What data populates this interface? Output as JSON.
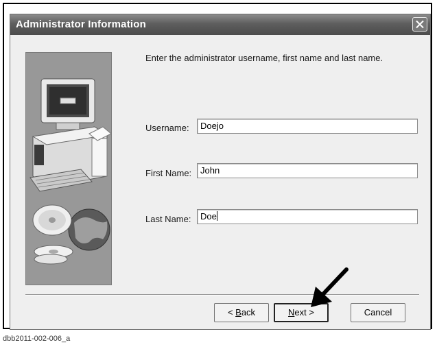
{
  "window": {
    "title": "Administrator Information",
    "close_icon": "close-icon"
  },
  "instruction": "Enter the administrator username, first name and last name.",
  "fields": {
    "username": {
      "label": "Username:",
      "value": "Doejo"
    },
    "first_name": {
      "label": "First Name:",
      "value": "John"
    },
    "last_name": {
      "label": "Last Name:",
      "value": "Doe"
    }
  },
  "buttons": {
    "back": {
      "prefix": "< ",
      "mnemonic": "B",
      "rest": "ack"
    },
    "next": {
      "mnemonic": "N",
      "rest": "ext",
      "suffix": " >"
    },
    "cancel": "Cancel"
  },
  "caption": "dbb2011-002-006_a",
  "illustration": "computer-cd-globe-illustration",
  "annotation": "pointer-arrow-icon"
}
